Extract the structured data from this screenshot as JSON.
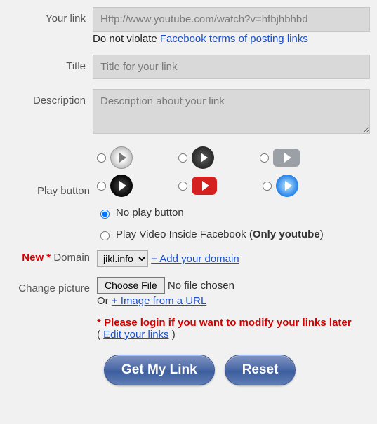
{
  "link": {
    "label": "Your link",
    "placeholder": "Http://www.youtube.com/watch?v=hfbjhbhbd",
    "hint_pre": "Do not violate ",
    "hint_link": "Facebook terms of posting links"
  },
  "title": {
    "label": "Title",
    "placeholder": "Title for your link"
  },
  "desc": {
    "label": "Description",
    "placeholder": "Description about your link"
  },
  "play": {
    "label": "Play button",
    "no_play": "No play button",
    "inside_pre": "Play Video Inside Facebook (",
    "inside_bold": "Only youtube",
    "inside_post": ")"
  },
  "domain": {
    "new": "New *",
    "label": "Domain",
    "selected": "jikl.info",
    "add": "+ Add your domain"
  },
  "picture": {
    "label": "Change picture",
    "choose": "Choose File",
    "no_file": "No file chosen",
    "or": "Or ",
    "from_url": "+ Image from a URL"
  },
  "login": {
    "star": "*",
    "msg": "Please login if you want to modify your links later",
    "open": "( ",
    "edit": "Edit your links",
    "close": " )"
  },
  "buttons": {
    "get": "Get My Link",
    "reset": "Reset"
  }
}
